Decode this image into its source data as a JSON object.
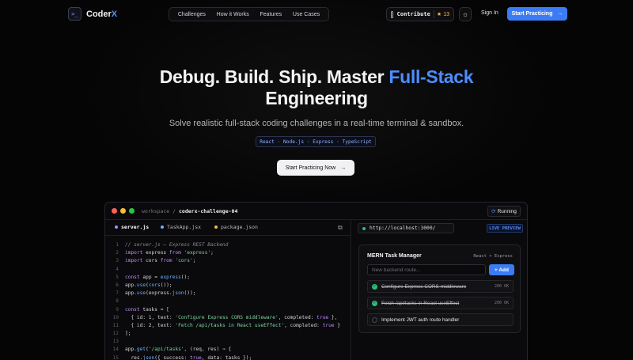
{
  "nav": {
    "logo_glyph": ">_",
    "logo_text_main": "Coder",
    "logo_text_accent": "X",
    "links": [
      "Challenges",
      "How it Works",
      "Features",
      "Use Cases"
    ],
    "contribute_label": "Contribute",
    "star_count": "13",
    "signin_label": "Sign In",
    "start_label": "Start Practicing",
    "arrow": "→"
  },
  "hero": {
    "title_line1_plain": "Debug. Build. Ship. Master ",
    "title_line1_accent": "Full-Stack",
    "title_line2": "Engineering",
    "subtitle": "Solve realistic full-stack coding challenges in a real-time terminal & sandbox.",
    "tags": "React · Node.js · Express · TypeScript",
    "cta_label": "Start Practicing Now",
    "cta_arrow": "→"
  },
  "workspace": {
    "breadcrumb_root": "workspace",
    "breadcrumb_sep": "/",
    "project": "coderx-challenge-04",
    "status": "Running",
    "tabs": [
      {
        "label": "server.js",
        "color": "#a98bff"
      },
      {
        "label": "TaskApp.jsx",
        "color": "#6fb0ff"
      },
      {
        "label": "package.json",
        "color": "#f5b942"
      }
    ],
    "code_lines": [
      "// server.js — Express REST Backend",
      "import express from 'express';",
      "import cors from 'cors';",
      "",
      "const app = express();",
      "app.use(cors());",
      "app.use(express.json());",
      "",
      "const tasks = [",
      "  { id: 1, text: 'Configure Express CORS middleware', completed: true },",
      "  { id: 2, text: 'Fetch /api/tasks in React useEffect', completed: true }",
      "];",
      "",
      "app.get('/api/tasks', (req, res) ⇒ {",
      "  res.json({ success: true, data: tasks });"
    ]
  },
  "preview": {
    "url": "http://localhost:3000/",
    "live_label": "LIVE PREVIEW",
    "app_title": "MERN Task Manager",
    "app_stack": "React + Express",
    "input_placeholder": "New backend route...",
    "add_label": "+ Add",
    "tasks": [
      {
        "text": "Configure Express CORS middleware",
        "done": true,
        "status": "200 OK"
      },
      {
        "text": "Fetch /api/tasks in React useEffect",
        "done": true,
        "status": "200 OK"
      },
      {
        "text": "Implement JWT auth route handler",
        "done": false,
        "status": ""
      }
    ]
  },
  "colors": {
    "accent": "#3b7cf5",
    "success": "#27c07a",
    "background": "#050506"
  }
}
